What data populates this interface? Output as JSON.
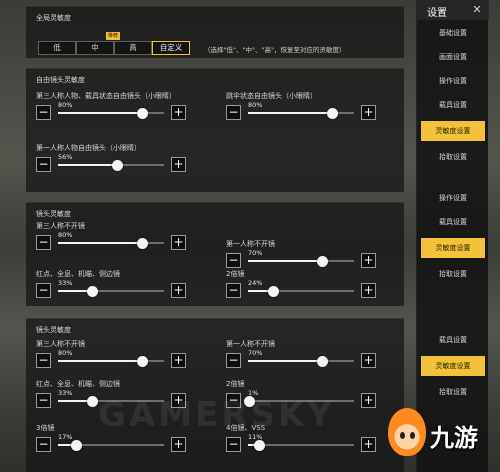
{
  "sidebar": {
    "title": "设置",
    "close_label": "✕",
    "groups": [
      [
        "基础设置",
        "画面设置",
        "操作设置",
        "载具设置",
        "灵敏度设置",
        "拾取设置"
      ],
      [
        "操作设置",
        "载具设置",
        "灵敏度设置",
        "拾取设置"
      ],
      [
        "载具设置",
        "灵敏度设置",
        "拾取设置"
      ]
    ]
  },
  "strip1": {
    "global_title": "全局灵敏度",
    "preset_options": [
      "低",
      "中",
      "高",
      "自定义"
    ],
    "preset_selected": "自定义",
    "preset_tag": "推荐",
    "preset_hint": "（选择\"低\"、\"中\"、\"高\"，恢复至对应的灵敏度）",
    "free_title": "自由镜头灵敏度",
    "sliders": [
      {
        "label": "第三人称人物、载具状态自由镜头（小眼睛）",
        "percent": 80
      },
      {
        "label": "跳伞状态自由镜头（小眼睛）",
        "percent": 80
      },
      {
        "label": "第一人称人物自由镜头（小眼睛）",
        "percent": 56
      }
    ]
  },
  "strip2": {
    "title": "镜头灵敏度",
    "sliders": [
      {
        "label": "第三人称不开镜",
        "percent": 80
      },
      {
        "label": "第一人称不开镜",
        "percent": 70
      },
      {
        "label": "红点、全息、机瞄、侧边镜",
        "percent": 33
      },
      {
        "label": "2倍镜",
        "percent": 24
      }
    ]
  },
  "strip3": {
    "title": "镜头灵敏度",
    "sliders": [
      {
        "label": "第三人称不开镜",
        "percent": 80
      },
      {
        "label": "第一人称不开镜",
        "percent": 70
      },
      {
        "label": "红点、全息、机瞄、侧边镜",
        "percent": 33
      },
      {
        "label": "2倍镜",
        "percent": 1
      },
      {
        "label": "3倍镜",
        "percent": 17
      },
      {
        "label": "4倍镜、VSS",
        "percent": 11
      }
    ]
  },
  "stepper": {
    "minus": "−",
    "plus": "+"
  },
  "watermark": "GAMERSKY",
  "logo_text": "九游"
}
